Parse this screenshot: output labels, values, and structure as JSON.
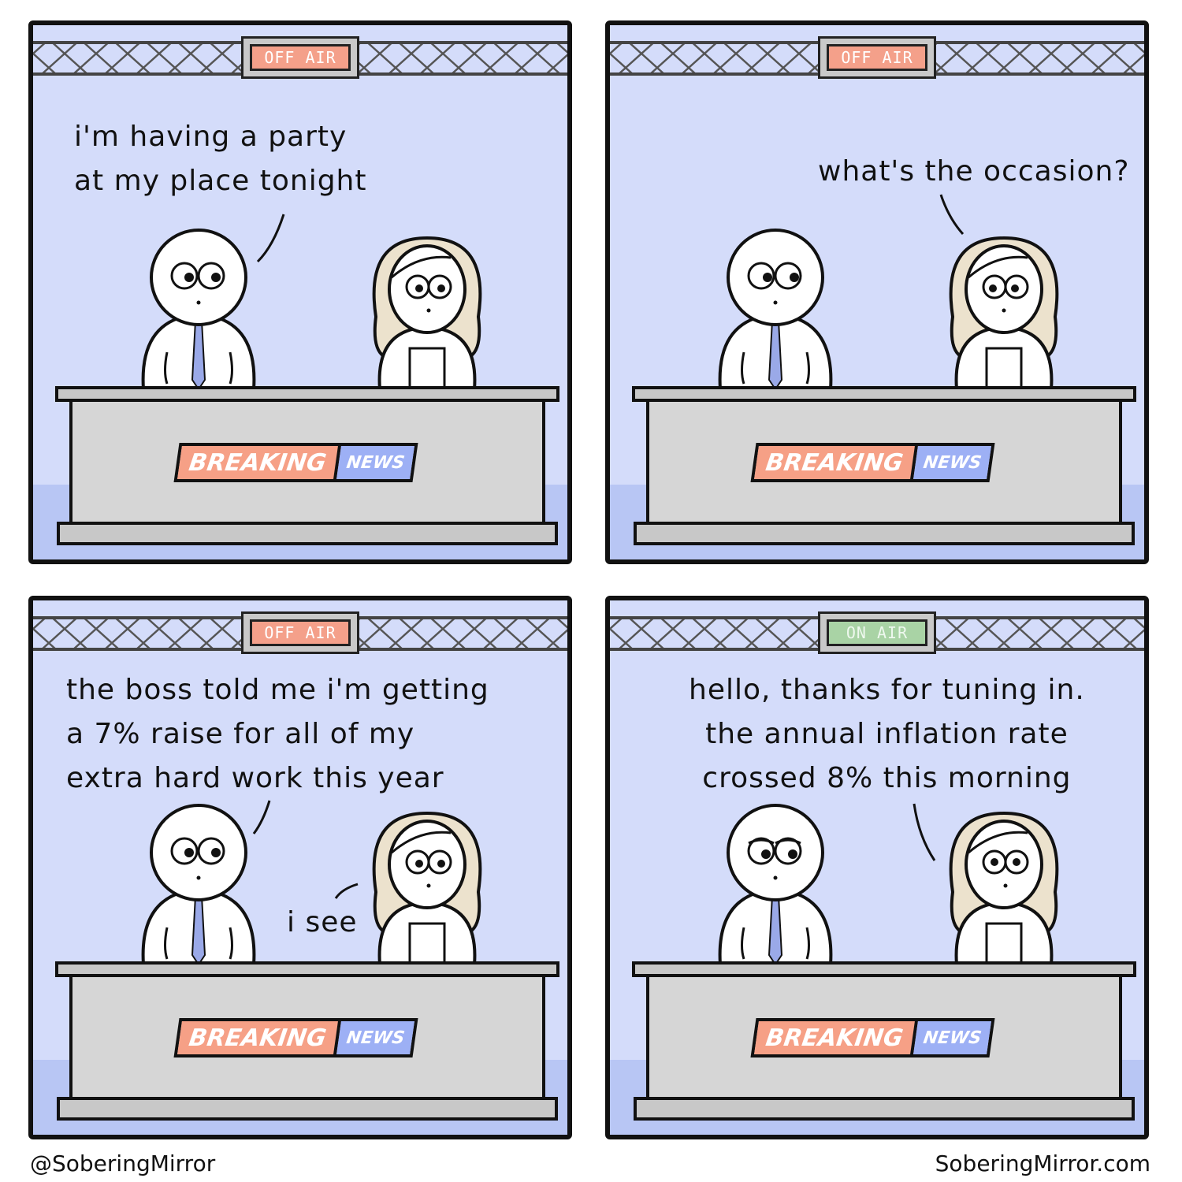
{
  "panels": [
    {
      "sign": "OFF AIR",
      "speech": "i'm having a party\nat my place tonight",
      "side_speech": "",
      "banner": {
        "breaking": "BREAKING",
        "news": "NEWS"
      }
    },
    {
      "sign": "OFF AIR",
      "speech": "what's the occasion?",
      "side_speech": "",
      "banner": {
        "breaking": "BREAKING",
        "news": "NEWS"
      }
    },
    {
      "sign": "OFF AIR",
      "speech": "the boss told me i'm getting\na 7% raise for all of my\nextra hard work this year",
      "side_speech": "i see",
      "banner": {
        "breaking": "BREAKING",
        "news": "NEWS"
      }
    },
    {
      "sign": "ON AIR",
      "speech": "hello, thanks for tuning in.\nthe annual inflation rate\ncrossed 8% this morning",
      "side_speech": "",
      "banner": {
        "breaking": "BREAKING",
        "news": "NEWS"
      }
    }
  ],
  "credits": {
    "left": "@SoberingMirror",
    "right": "SoberingMirror.com"
  },
  "colors": {
    "background": "#d4dcfa",
    "floor": "#b8c6f4",
    "desk": "#d6d6d6",
    "breaking": "#f6a086",
    "news": "#9db0f5",
    "off_air": "#f4a08a",
    "on_air": "#a9d3a5",
    "hair": "#ece2cd",
    "tie": "#9aa9e8"
  }
}
